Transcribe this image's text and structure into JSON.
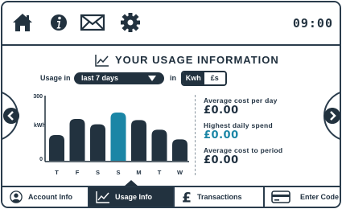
{
  "header": {
    "time": "09:00",
    "icons": [
      "home-icon",
      "info-icon",
      "mail-icon",
      "gear-icon"
    ]
  },
  "page": {
    "title": "YOUR USAGE INFORMATION"
  },
  "usage": {
    "label": "Usage in",
    "period": "last 7 days",
    "in_label": "in",
    "units": [
      "Kwh",
      "£s"
    ],
    "selected_unit": "Kwh"
  },
  "chart_data": {
    "type": "bar",
    "categories": [
      "T",
      "F",
      "S",
      "S",
      "M",
      "T",
      "W"
    ],
    "values": [
      120,
      195,
      170,
      225,
      190,
      145,
      100
    ],
    "highlight_index": 3,
    "ylabel": "kWh",
    "ytick_top": "300",
    "ytick_bottom": "0",
    "ylim": [
      0,
      300
    ],
    "colors": {
      "bar": "#22323f",
      "highlight": "#1b86a6"
    }
  },
  "stats": {
    "avg_day_label": "Average cost per day",
    "avg_day_value": "£0.00",
    "highest_label": "Highest daily spend",
    "highest_value": "£0.00",
    "avg_period_label": "Average cost to period",
    "avg_period_value": "£0.00"
  },
  "tabs": {
    "account": "Account Info",
    "usage": "Usage Info",
    "transactions": "Transactions",
    "enter_code": "Enter Code"
  },
  "colors": {
    "dark": "#22323f",
    "accent": "#1b86a6"
  }
}
